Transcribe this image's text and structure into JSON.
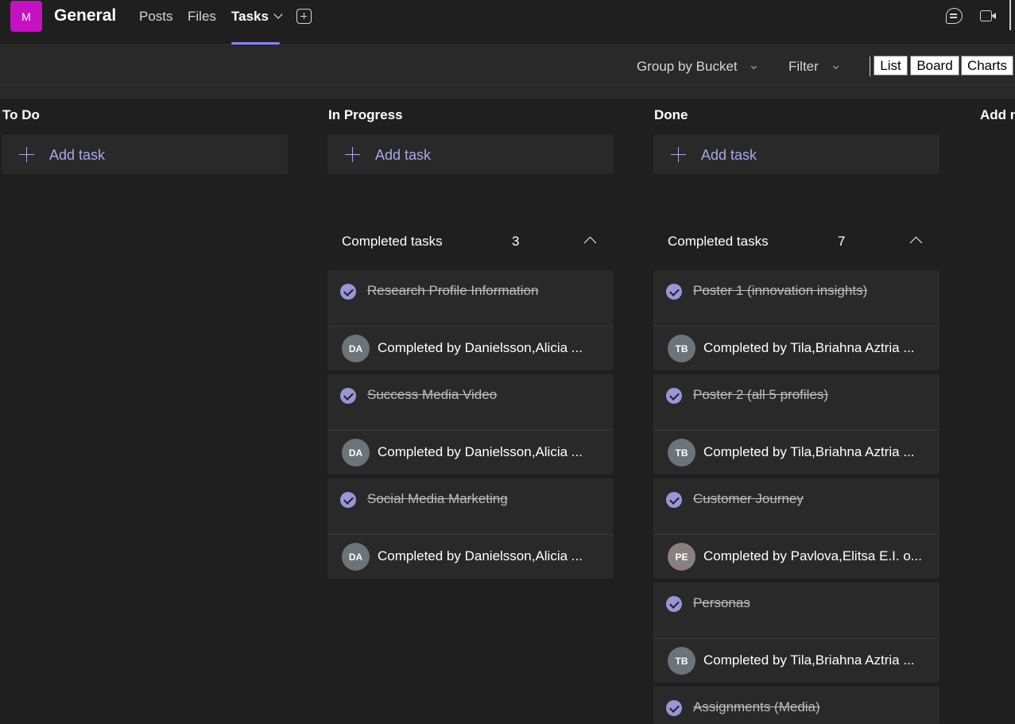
{
  "header": {
    "team_initial": "M",
    "channel_name": "General",
    "tabs": [
      "Posts",
      "Files",
      "Tasks"
    ],
    "active_tab": "Tasks"
  },
  "toolbar": {
    "group_by_label": "Group by Bucket",
    "filter_label": "Filter",
    "views": [
      "List",
      "Board",
      "Charts"
    ]
  },
  "board": {
    "add_task_label": "Add task",
    "completed_tasks_label": "Completed tasks",
    "columns": [
      {
        "title": "To Do"
      },
      {
        "title": "In Progress",
        "completed_count": "3",
        "tasks": [
          {
            "title": "Research Profile Information",
            "initials": "DA",
            "completed_by": "Completed by Danielsson,Alicia ..."
          },
          {
            "title": "Success Media Video",
            "initials": "DA",
            "completed_by": "Completed by Danielsson,Alicia ..."
          },
          {
            "title": "Social Media Marketing",
            "initials": "DA",
            "completed_by": "Completed by Danielsson,Alicia ..."
          }
        ]
      },
      {
        "title": "Done",
        "completed_count": "7",
        "tasks": [
          {
            "title": "Poster 1 (innovation insights)",
            "initials": "TB",
            "completed_by": "Completed by Tila,Briahna Aztria ..."
          },
          {
            "title": "Poster 2 (all 5 profiles)",
            "initials": "TB",
            "completed_by": "Completed by Tila,Briahna Aztria ..."
          },
          {
            "title": "Customer Journey",
            "initials": "PE",
            "completed_by": "Completed by Pavlova,Elitsa E.I. o..."
          },
          {
            "title": "Personas",
            "initials": "TB",
            "completed_by": "Completed by Tila,Briahna Aztria ..."
          },
          {
            "title": "Assignments (Media)",
            "initials": "",
            "completed_by": ""
          }
        ]
      },
      {
        "title": "Add n"
      }
    ]
  },
  "colors": {
    "background": "#1f1f1f",
    "card": "#292929",
    "accent": "#7f85f5",
    "add_task_text": "#a6a9e8",
    "check_fill": "#9896d6",
    "team_avatar": "#c511c1",
    "avatar_grey": "#6b7478",
    "avatar_pe": "#8a7f7f"
  }
}
